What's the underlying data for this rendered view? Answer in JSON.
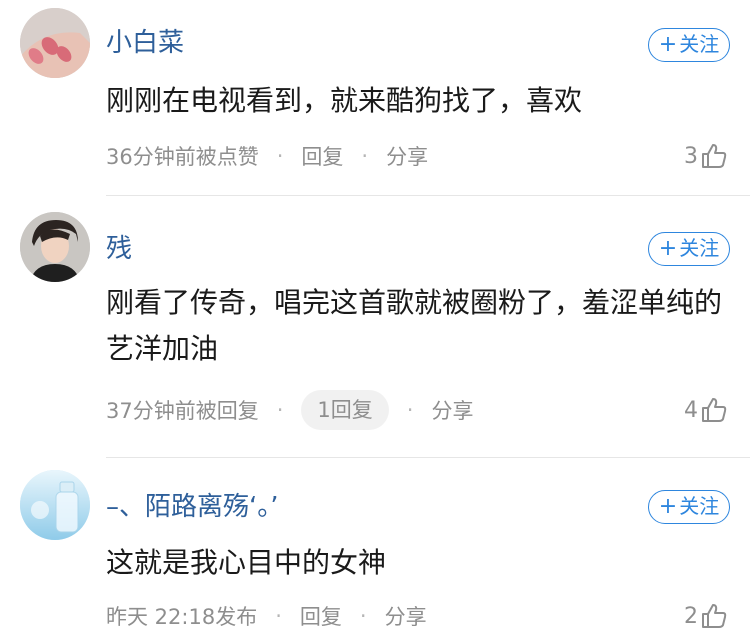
{
  "follow_label": "关注",
  "comments": [
    {
      "username": "小白菜",
      "text": "刚刚在电视看到，就来酷狗找了，喜欢",
      "time": "36分钟前被点赞",
      "reply_label": "回复",
      "share_label": "分享",
      "likes": "3",
      "avatar": "hand-nails"
    },
    {
      "username": "残",
      "text": "刚看了传奇，唱完这首歌就被圈粉了，羞涩单纯的艺洋加油",
      "time": "37分钟前被回复",
      "reply_label": "1回复",
      "share_label": "分享",
      "likes": "4",
      "avatar": "young-man-portrait"
    },
    {
      "username": "–、陌路离殇‘。’",
      "text": "这就是我心目中的女神",
      "time": "昨天 22:18发布",
      "reply_label": "回复",
      "share_label": "分享",
      "likes": "2",
      "avatar": "glass-bottle-sky"
    }
  ],
  "colors": {
    "username": "#2e5f9a",
    "accent": "#2e86de",
    "meta": "#8e8e8e"
  }
}
